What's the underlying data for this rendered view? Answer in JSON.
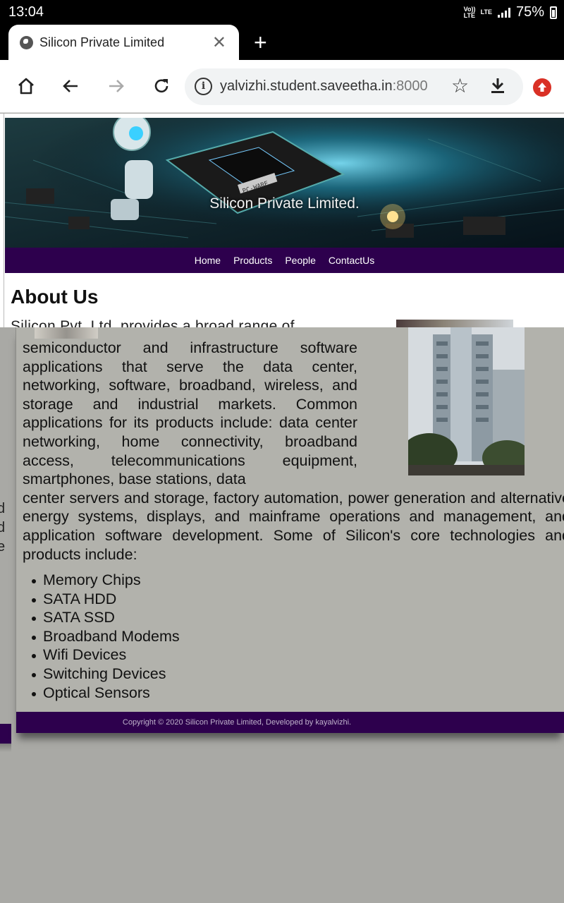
{
  "status_bar": {
    "time": "13:04",
    "volte_label": "Vo)) LTE",
    "lte_label": "LTE",
    "battery": "75%"
  },
  "browser": {
    "tab_title": "Silicon Private Limited",
    "url_host": "yalvizhi.student.saveetha.in",
    "url_port": ":8000"
  },
  "site": {
    "banner_title": "Silicon Private Limited.",
    "chip_label": "PC-WARE",
    "nav": [
      "Home",
      "Products",
      "People",
      "ContactUs"
    ],
    "about_heading": "About Us",
    "intro_ghost": "Silicon Pvt. Ltd. provides a broad range of",
    "edge_fragments": [
      "d",
      "d",
      "e"
    ],
    "paragraph_narrow": "semiconductor and infrastructure software applications that serve the data center, networking, software, broadband, wireless, and storage and industrial markets. Common applications for its products include: data center networking, home connectivity, broadband access, telecommunications equipment, smartphones, base stations, data",
    "paragraph_wide": "center servers and storage, factory automation, power generation and alternative energy systems, displays, and mainframe operations and management, and application software development. Some of Silicon's core technologies and products include:",
    "products": [
      "Memory Chips",
      "SATA HDD",
      "SATA SSD",
      "Broadband Modems",
      "Wifi Devices",
      "Switching Devices",
      "Optical Sensors"
    ],
    "footer": "Copyright © 2020 Silicon Private Limited, Developed by kayalvizhi."
  },
  "colors": {
    "nav_bg": "#2d004d",
    "page_overlay": "#b2b2ac",
    "update_badge": "#d93025"
  },
  "icons": [
    "globe-icon",
    "close-icon",
    "plus-icon",
    "home-icon",
    "back-arrow-icon",
    "forward-arrow-icon",
    "reload-icon",
    "info-icon",
    "star-icon",
    "download-icon",
    "update-icon"
  ]
}
